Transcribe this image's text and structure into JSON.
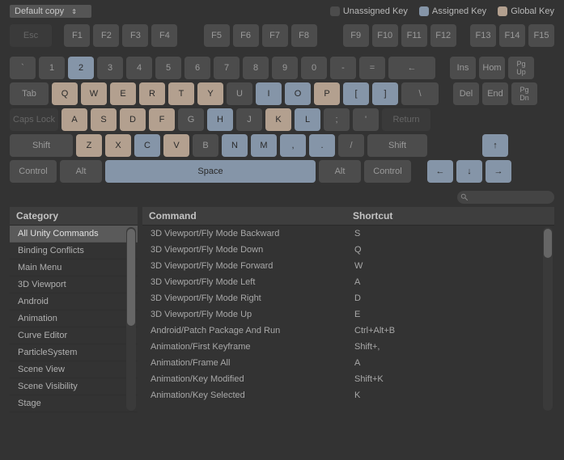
{
  "profile": "Default copy",
  "legend": {
    "unassigned": "Unassigned Key",
    "assigned": "Assigned Key",
    "global": "Global Key"
  },
  "keys": {
    "esc": "Esc",
    "f1": "F1",
    "f2": "F2",
    "f3": "F3",
    "f4": "F4",
    "f5": "F5",
    "f6": "F6",
    "f7": "F7",
    "f8": "F8",
    "f9": "F9",
    "f10": "F10",
    "f11": "F11",
    "f12": "F12",
    "f13": "F13",
    "f14": "F14",
    "f15": "F15",
    "backtick": "`",
    "n1": "1",
    "n2": "2",
    "n3": "3",
    "n4": "4",
    "n5": "5",
    "n6": "6",
    "n7": "7",
    "n8": "8",
    "n9": "9",
    "n0": "0",
    "minus": "-",
    "equals": "=",
    "bksp": "←",
    "tab": "Tab",
    "q": "Q",
    "w": "W",
    "e": "E",
    "r": "R",
    "t": "T",
    "y": "Y",
    "u": "U",
    "i": "I",
    "o": "O",
    "p": "P",
    "lbrk": "[",
    "rbrk": "]",
    "bslash": "\\",
    "caps": "Caps Lock",
    "a": "A",
    "s": "S",
    "d": "D",
    "f": "F",
    "g": "G",
    "h": "H",
    "j": "J",
    "k": "K",
    "l": "L",
    "semi": ";",
    "quote": "'",
    "ret": "Return",
    "lshift": "Shift",
    "z": "Z",
    "x": "X",
    "c": "C",
    "v": "V",
    "b": "B",
    "nn": "N",
    "m": "M",
    "comma": ",",
    "dot": ".",
    "slash": "/",
    "rshift": "Shift",
    "lctrl": "Control",
    "lalt": "Alt",
    "space": "Space",
    "ralt": "Alt",
    "rctrl": "Control",
    "ins": "Ins",
    "home": "Hom",
    "pgup1": "Pg",
    "pgup2": "Up",
    "del": "Del",
    "end": "End",
    "pgdn1": "Pg",
    "pgdn2": "Dn",
    "up": "↑",
    "left": "←",
    "down": "↓",
    "right": "→"
  },
  "search": {
    "placeholder": ""
  },
  "headers": {
    "category": "Category",
    "command": "Command",
    "shortcut": "Shortcut"
  },
  "categories": [
    "All Unity Commands",
    "Binding Conflicts",
    "Main Menu",
    "3D Viewport",
    "Android",
    "Animation",
    "Curve Editor",
    "ParticleSystem",
    "Scene View",
    "Scene Visibility",
    "Stage"
  ],
  "selected_category_index": 0,
  "commands": [
    {
      "c": "3D Viewport/Fly Mode Backward",
      "s": "S"
    },
    {
      "c": "3D Viewport/Fly Mode Down",
      "s": "Q"
    },
    {
      "c": "3D Viewport/Fly Mode Forward",
      "s": "W"
    },
    {
      "c": "3D Viewport/Fly Mode Left",
      "s": "A"
    },
    {
      "c": "3D Viewport/Fly Mode Right",
      "s": "D"
    },
    {
      "c": "3D Viewport/Fly Mode Up",
      "s": "E"
    },
    {
      "c": "Android/Patch Package And Run",
      "s": "Ctrl+Alt+B"
    },
    {
      "c": "Animation/First Keyframe",
      "s": "Shift+,"
    },
    {
      "c": "Animation/Frame All",
      "s": "A"
    },
    {
      "c": "Animation/Key Modified",
      "s": "Shift+K"
    },
    {
      "c": "Animation/Key Selected",
      "s": "K"
    }
  ]
}
